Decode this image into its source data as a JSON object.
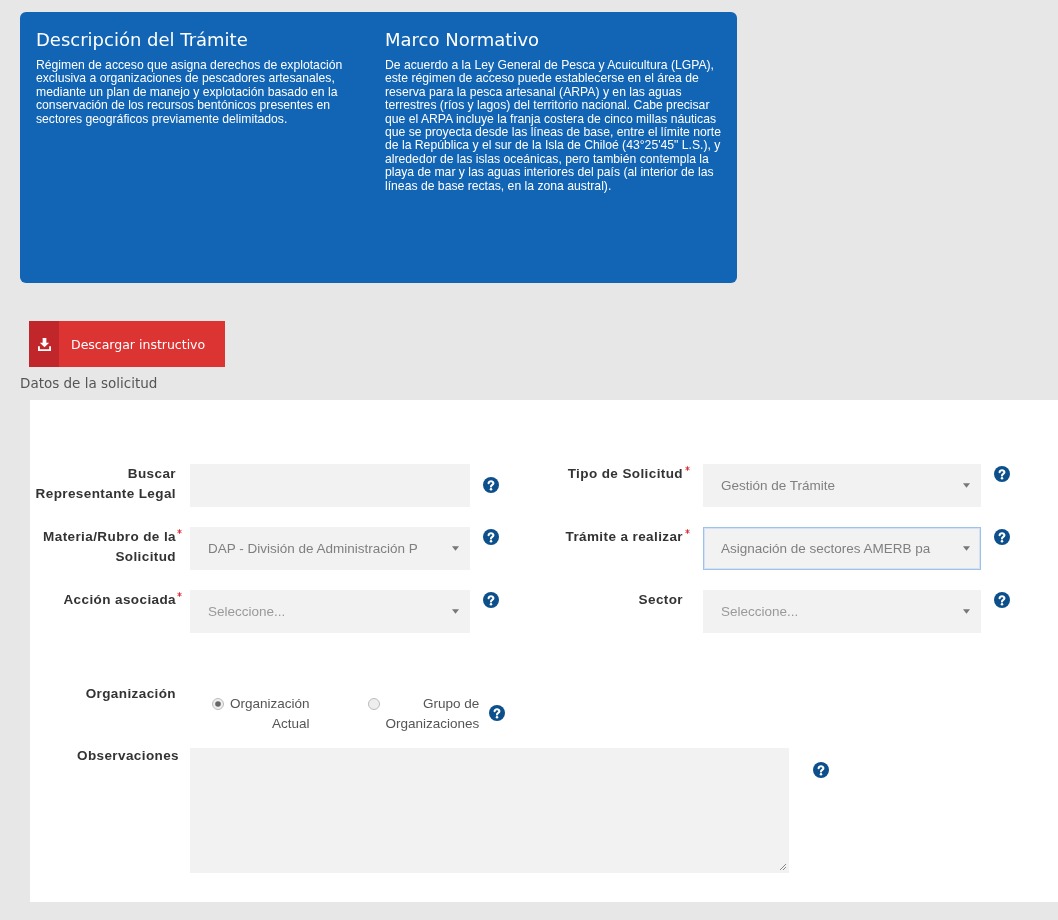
{
  "panels": [
    {
      "title": "Descripción del Trámite",
      "text": "Régimen de acceso que asigna derechos de explotación exclusiva a organizaciones de pescadores artesanales, mediante un plan de manejo y explotación basado en la conservación de los recursos bentónicos presentes en sectores geográficos previamente delimitados."
    },
    {
      "title": "Marco Normativo",
      "text": "De acuerdo a la Ley General de Pesca y Acuicultura (LGPA), este régimen de acceso puede establecerse en el área de reserva para la pesca artesanal (ARPA) y en las aguas terrestres (ríos y lagos) del territorio nacional. Cabe precisar que el ARPA incluye la franja costera de cinco millas náuticas que se proyecta desde las líneas de base, entre el límite norte de la República y el sur de la Isla de Chiloé (43°25'45\" L.S.), y alrededor de las islas oceánicas, pero también contempla la playa de mar y las aguas interiores del país (al interior de las líneas de base rectas, en la zona austral)."
    }
  ],
  "download_button": {
    "label": "Descargar instructivo"
  },
  "section_title": "Datos de la solicitud",
  "rows": [
    {
      "left": {
        "label": "Buscar Representante Legal",
        "kind": "text",
        "required": false
      },
      "right": {
        "label": "Tipo de Solicitud",
        "kind": "select",
        "value": "Gestión de Trámite",
        "required": true,
        "focused": false
      }
    },
    {
      "left": {
        "label": "Materia/Rubro de la Solicitud",
        "kind": "select",
        "value": "DAP - División de Administración P",
        "required": true,
        "focused": false
      },
      "right": {
        "label": "Trámite a realizar",
        "kind": "select",
        "value": "Asignación de sectores AMERB pa",
        "required": true,
        "focused": true
      }
    },
    {
      "left": {
        "label": "Acción asociada",
        "kind": "select",
        "placeholder": "Seleccione...",
        "required": true,
        "focused": false
      },
      "right": {
        "label": "Sector",
        "kind": "select",
        "placeholder": "Seleccione...",
        "required": false,
        "focused": false
      }
    }
  ],
  "organization": {
    "label": "Organización",
    "options": [
      {
        "label": "Organización Actual",
        "selected": true
      },
      {
        "label": "Grupo de Organizaciones",
        "selected": false
      }
    ]
  },
  "observations": {
    "label": "Observaciones"
  }
}
